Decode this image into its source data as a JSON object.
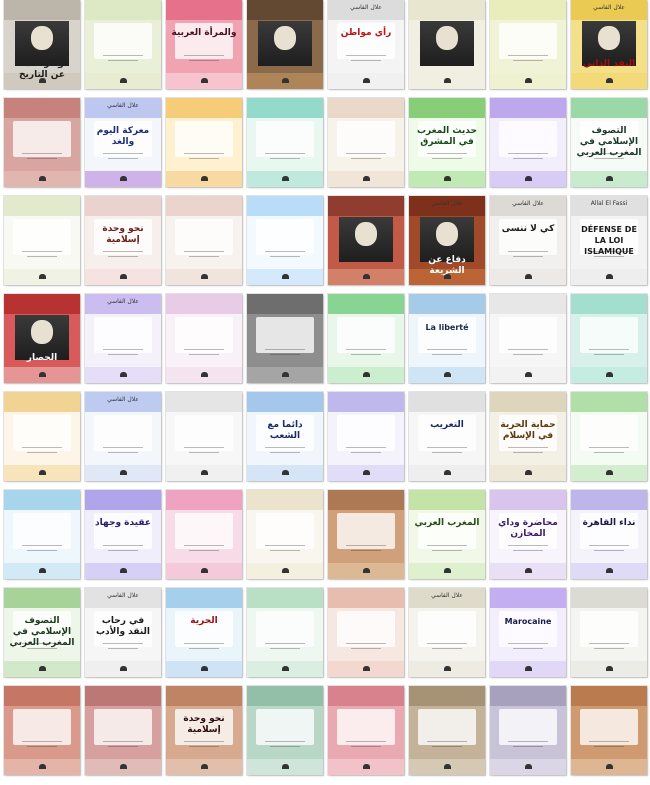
{
  "books": [
    {
      "title": "أوكار تحدث عن التاريخ",
      "author": "",
      "bg": "#d8d4cc",
      "top": "#b9b2a6",
      "bottom": "#cfc8bb",
      "title_color": "#202020",
      "style": "photo"
    },
    {
      "title": "",
      "author": "",
      "bg": "#eaf0d8",
      "top": "#dce7c2",
      "bottom": "#e6ebd2",
      "title_color": "#2b4a2b",
      "style": "plain"
    },
    {
      "title": "والمرأة العربية",
      "author": "",
      "bg": "#f2a3b2",
      "top": "#e46b86",
      "bottom": "#f7c9d2",
      "title_color": "#4a1023",
      "style": "plain"
    },
    {
      "title": "",
      "author": "",
      "bg": "#8a6a4a",
      "top": "#5e4630",
      "bottom": "#b48a5c",
      "title_color": "#ffffff",
      "style": "photo"
    },
    {
      "title": "رأي مواطن",
      "author": "علال الفاسي",
      "bg": "#f4f4f4",
      "top": "#d9d9d9",
      "bottom": "#f0f0f0",
      "title_color": "#c11212",
      "style": "plain"
    },
    {
      "title": "",
      "author": "",
      "bg": "#f0efe2",
      "top": "#e7e4cd",
      "bottom": "#f1efe0",
      "title_color": "#2a2a2a",
      "style": "photo"
    },
    {
      "title": "",
      "author": "",
      "bg": "#f1f3d6",
      "top": "#e8ecb9",
      "bottom": "#eef1cf",
      "title_color": "#2b3b6a",
      "style": "plain"
    },
    {
      "title": "النقد الذاتي",
      "author": "علال الفاسي",
      "bg": "#f5e08a",
      "top": "#e9c84c",
      "bottom": "#f2d774",
      "title_color": "#a01010",
      "style": "photo"
    },
    {
      "title": "",
      "author": "",
      "bg": "#d8a5a0",
      "top": "#c48077",
      "bottom": "#e2b8b1",
      "title_color": "#3a1515",
      "style": "plain"
    },
    {
      "title": "معركة اليوم والغد",
      "author": "علال الفاسي",
      "bg": "#f3f6fb",
      "top": "#b7c2ee",
      "bottom": "#c8a6e6",
      "title_color": "#1c2c7a",
      "style": "plain"
    },
    {
      "title": "",
      "author": "",
      "bg": "#fff1cf",
      "top": "#f6c86e",
      "bottom": "#f8d59a",
      "title_color": "#7a2c0c",
      "style": "plain"
    },
    {
      "title": "",
      "author": "",
      "bg": "#e9f7f1",
      "top": "#8ad6c6",
      "bottom": "#b8e6da",
      "title_color": "#1a4a3a",
      "style": "plain"
    },
    {
      "title": "",
      "author": "",
      "bg": "#f7f2ea",
      "top": "#e8d6c5",
      "bottom": "#efe3d3",
      "title_color": "#2a2a2a",
      "style": "plain"
    },
    {
      "title": "حديث المغرب في المشرق",
      "author": "",
      "bg": "#eefbe8",
      "top": "#7cc86a",
      "bottom": "#b8e5a9",
      "title_color": "#1a4a1a",
      "style": "plain"
    },
    {
      "title": "",
      "author": "",
      "bg": "#f3eefc",
      "top": "#b7a0ec",
      "bottom": "#d2c4f4",
      "title_color": "#2a1a6a",
      "style": "plain"
    },
    {
      "title": "التصوف الإسلامي في المغرب العربي",
      "author": "",
      "bg": "#f7fbf7",
      "top": "#8fd49e",
      "bottom": "#bfe6c6",
      "title_color": "#1a3a2a",
      "style": "plain"
    },
    {
      "title": "",
      "author": "",
      "bg": "#f8f9f2",
      "top": "#dfe7c9",
      "bottom": "#eef1e0",
      "title_color": "#1a2a6a",
      "style": "plain"
    },
    {
      "title": "نحو وحدة إسلامية",
      "author": "",
      "bg": "#f6efec",
      "top": "#e9cfcb",
      "bottom": "#f3e1de",
      "title_color": "#6a1a1a",
      "style": "plain"
    },
    {
      "title": "",
      "author": "",
      "bg": "#f7f2ee",
      "top": "#e8d0c8",
      "bottom": "#f0e0da",
      "title_color": "#6a1a1a",
      "style": "plain"
    },
    {
      "title": "",
      "author": "",
      "bg": "#f2f9ff",
      "top": "#b3d9f7",
      "bottom": "#cfe8fb",
      "title_color": "#1a3a6a",
      "style": "plain"
    },
    {
      "title": "",
      "author": "",
      "bg": "#c15a46",
      "top": "#8b3a2c",
      "bottom": "#d6876f",
      "title_color": "#ffffff",
      "style": "photo"
    },
    {
      "title": "دفاع عن الشريعة",
      "author": "علال الفاسي",
      "bg": "#a04a2a",
      "top": "#7a2e1a",
      "bottom": "#c06a3a",
      "title_color": "#ffffff",
      "style": "photo"
    },
    {
      "title": "كي لا ننسى",
      "author": "علال الفاسي",
      "bg": "#f2f0ee",
      "top": "#dad6d2",
      "bottom": "#ece8e4",
      "title_color": "#1a1a1a",
      "style": "plain"
    },
    {
      "title": "DÉFENSE DE LA LOI ISLAMIQUE",
      "author": "Allal El Fassi",
      "bg": "#f3f3f3",
      "top": "#dedede",
      "bottom": "#ececec",
      "title_color": "#1a1a1a",
      "style": "plain",
      "latin": true
    },
    {
      "title": "الحصار",
      "author": "",
      "bg": "#d95a5a",
      "top": "#b52e2e",
      "bottom": "#e7a0a0",
      "title_color": "#ffffff",
      "style": "photo"
    },
    {
      "title": "",
      "author": "علال الفاسي",
      "bg": "#f4f1fb",
      "top": "#c6b7ee",
      "bottom": "#e3dbf7",
      "title_color": "#2a1a6a",
      "style": "plain"
    },
    {
      "title": "",
      "author": "",
      "bg": "#f8f1f7",
      "top": "#e6c6e2",
      "bottom": "#f2e2ef",
      "title_color": "#4a1a4a",
      "style": "plain"
    },
    {
      "title": "",
      "author": "",
      "bg": "#8e8e8e",
      "top": "#6a6a6a",
      "bottom": "#a9a9a9",
      "title_color": "#ffffff",
      "style": "plain"
    },
    {
      "title": "",
      "author": "",
      "bg": "#e8f7ea",
      "top": "#7ccf8a",
      "bottom": "#c4ecc9",
      "title_color": "#1a4a2a",
      "style": "plain"
    },
    {
      "title": "La liberté",
      "author": "",
      "bg": "#eef6fb",
      "top": "#9cc7e6",
      "bottom": "#c9e2f3",
      "title_color": "#1a2a4a",
      "style": "plain",
      "latin": true
    },
    {
      "title": "",
      "author": "",
      "bg": "#f6f6f6",
      "top": "#e6e6e6",
      "bottom": "#f1f1f1",
      "title_color": "#1a1a1a",
      "style": "plain"
    },
    {
      "title": "",
      "author": "",
      "bg": "#d7f0e9",
      "top": "#9fdccc",
      "bottom": "#c2ebdf",
      "title_color": "#1a4a3a",
      "style": "plain"
    },
    {
      "title": "",
      "author": "",
      "bg": "#fdf6e8",
      "top": "#f0cf8a",
      "bottom": "#f7e0b3",
      "title_color": "#5a2a0a",
      "style": "plain"
    },
    {
      "title": "",
      "author": "علال الفاسي",
      "bg": "#f3f6fb",
      "top": "#b8c7ee",
      "bottom": "#dce4f6",
      "title_color": "#1a2a6a",
      "style": "plain"
    },
    {
      "title": "",
      "author": "",
      "bg": "#f7f7f7",
      "top": "#e2e2e2",
      "bottom": "#efefef",
      "title_color": "#2a2a2a",
      "style": "plain"
    },
    {
      "title": "دائما مع الشعب",
      "author": "",
      "bg": "#f0f6fb",
      "top": "#9dc2ea",
      "bottom": "#d0e1f4",
      "title_color": "#1a2a6a",
      "style": "plain"
    },
    {
      "title": "",
      "author": "",
      "bg": "#f4f2fb",
      "top": "#b9b1ea",
      "bottom": "#ddd8f6",
      "title_color": "#2a1a6a",
      "style": "plain"
    },
    {
      "title": "التعريب",
      "author": "",
      "bg": "#f6f6f6",
      "top": "#dedede",
      "bottom": "#ececec",
      "title_color": "#1a2a6a",
      "style": "plain"
    },
    {
      "title": "حماية الحرية في الإسلام",
      "author": "",
      "bg": "#f3f0e6",
      "top": "#dcd2b8",
      "bottom": "#ebe6d5",
      "title_color": "#5a3a0a",
      "style": "plain"
    },
    {
      "title": "",
      "author": "",
      "bg": "#f4fbf2",
      "top": "#a8dca0",
      "bottom": "#cdebc8",
      "title_color": "#1a4a1a",
      "style": "plain"
    },
    {
      "title": "",
      "author": "",
      "bg": "#eef7fb",
      "top": "#9fd1ea",
      "bottom": "#cbe7f4",
      "title_color": "#1a2a4a",
      "style": "plain"
    },
    {
      "title": "عقيدة وجهاد",
      "author": "",
      "bg": "#f0eefb",
      "top": "#a99be8",
      "bottom": "#d1caf5",
      "title_color": "#2a1a6a",
      "style": "plain"
    },
    {
      "title": "",
      "author": "",
      "bg": "#f7dbe6",
      "top": "#ec9cbc",
      "bottom": "#f3c6d7",
      "title_color": "#6a1a3a",
      "style": "plain"
    },
    {
      "title": "",
      "author": "",
      "bg": "#f8f6ef",
      "top": "#e9e1c8",
      "bottom": "#f3eedd",
      "title_color": "#3a2a1a",
      "style": "plain"
    },
    {
      "title": "",
      "author": "",
      "bg": "#cfa07a",
      "top": "#a87450",
      "bottom": "#dfbc99",
      "title_color": "#3a1a0a",
      "style": "plain"
    },
    {
      "title": "المغرب العربي",
      "author": "",
      "bg": "#f2f8e8",
      "top": "#bfe1a0",
      "bottom": "#dbefc9",
      "title_color": "#2a4a1a",
      "style": "plain"
    },
    {
      "title": "محاضرة وداي المخازن",
      "author": "",
      "bg": "#f8f4fb",
      "top": "#d4bfea",
      "bottom": "#e8dcf4",
      "title_color": "#3a1a6a",
      "style": "plain"
    },
    {
      "title": "نداء القاهرة",
      "author": "",
      "bg": "#f4f2fb",
      "top": "#b8aee8",
      "bottom": "#dbd6f5",
      "title_color": "#1a1a4a",
      "style": "plain"
    },
    {
      "title": "التصوف الإسلامي في المغرب العربي",
      "author": "",
      "bg": "#eef6ea",
      "top": "#9fcf8f",
      "bottom": "#cbe6c2",
      "title_color": "#1a3a1a",
      "style": "plain"
    },
    {
      "title": "في رحاب النقد والأدب",
      "author": "علال الفاسي",
      "bg": "#f6f6f6",
      "top": "#e0e0e0",
      "bottom": "#ededed",
      "title_color": "#1a1a1a",
      "style": "plain"
    },
    {
      "title": "الحرية",
      "author": "",
      "bg": "#eaf4fb",
      "top": "#9fcbea",
      "bottom": "#c9e1f4",
      "title_color": "#a01010",
      "style": "plain"
    },
    {
      "title": "",
      "author": "",
      "bg": "#eef7f0",
      "top": "#b3dcbf",
      "bottom": "#d7ecdf",
      "title_color": "#1a3a2a",
      "style": "plain"
    },
    {
      "title": "",
      "author": "",
      "bg": "#f6e7e1",
      "top": "#e4b8a8",
      "bottom": "#f1d5cb",
      "title_color": "#5a1a1a",
      "style": "plain"
    },
    {
      "title": "",
      "author": "علال الفاسي",
      "bg": "#f4f3ee",
      "top": "#ddd8c6",
      "bottom": "#ece9e0",
      "title_color": "#3a2a1a",
      "style": "plain"
    },
    {
      "title": "Marocaine",
      "author": "",
      "bg": "#f3eefc",
      "top": "#bca6ee",
      "bottom": "#ddd2f6",
      "title_color": "#1a1a4a",
      "style": "plain",
      "latin": true
    },
    {
      "title": "",
      "author": "",
      "bg": "#f4f4f0",
      "top": "#d8d8cf",
      "bottom": "#eaeae4",
      "title_color": "#2a2a2a",
      "style": "plain"
    },
    {
      "title": "",
      "author": "",
      "bg": "#d99a8b",
      "top": "#c27260",
      "bottom": "#e5b9ae",
      "title_color": "#3a0a0a",
      "style": "plain"
    },
    {
      "title": "",
      "author": "",
      "bg": "#d5a09d",
      "top": "#b87370",
      "bottom": "#e2bfbd",
      "title_color": "#3a0a0a",
      "style": "plain"
    },
    {
      "title": "نحو وحدة إسلامية",
      "author": "",
      "bg": "#d7a98e",
      "top": "#bb7f5f",
      "bottom": "#e4c3b0",
      "title_color": "#2a0a0a",
      "style": "plain"
    },
    {
      "title": "",
      "author": "",
      "bg": "#b9d7c7",
      "top": "#8fbba3",
      "bottom": "#d2e7dc",
      "title_color": "#1a3a2a",
      "style": "plain"
    },
    {
      "title": "",
      "author": "",
      "bg": "#eaa9b0",
      "top": "#d57d88",
      "bottom": "#f2c7cc",
      "title_color": "#3a0a1a",
      "style": "plain"
    },
    {
      "title": "",
      "author": "",
      "bg": "#c4b299",
      "top": "#a38e70",
      "bottom": "#d8cbb9",
      "title_color": "#2a1a0a",
      "style": "plain"
    },
    {
      "title": "",
      "author": "",
      "bg": "#c8c3d7",
      "top": "#a49dbb",
      "bottom": "#ddd9e8",
      "title_color": "#1a1a3a",
      "style": "plain"
    },
    {
      "title": "",
      "author": "",
      "bg": "#cf9a70",
      "top": "#b7784a",
      "bottom": "#e1bb9a",
      "title_color": "#2a0a0a",
      "style": "plain"
    }
  ]
}
